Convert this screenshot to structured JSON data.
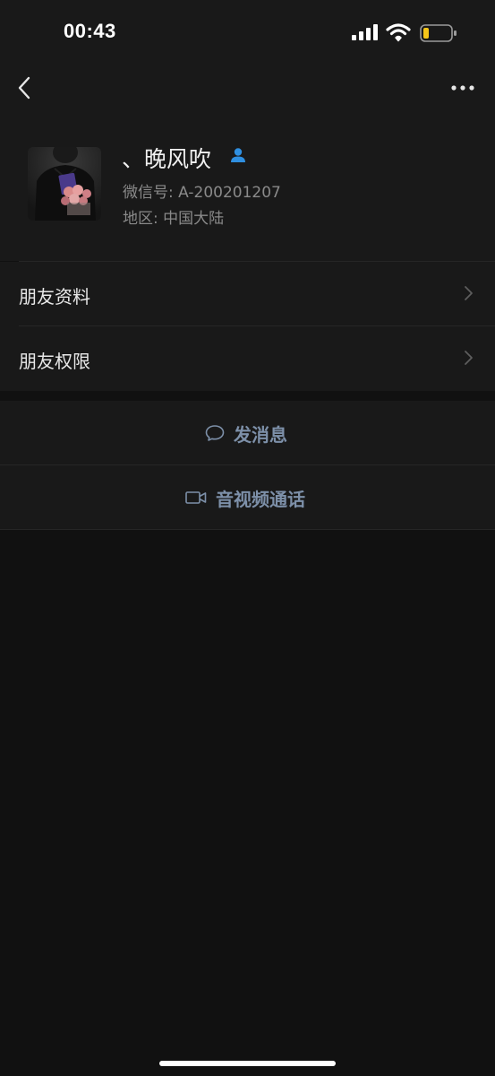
{
  "status_bar": {
    "time": "00:43",
    "icons": [
      "signal-icon",
      "wifi-icon",
      "battery-icon"
    ],
    "battery_color": "#f5c518"
  },
  "nav": {
    "icons": [
      "back-icon",
      "more-icon"
    ]
  },
  "profile": {
    "nickname": "、晚风吹",
    "wechat_id": "微信号: A-200201207",
    "region": "地区: 中国大陆",
    "badge_icon": "contact-person-icon",
    "badge_color": "#2f8fe0"
  },
  "menu": {
    "friend_profile": "朋友资料",
    "friend_permissions": "朋友权限"
  },
  "actions": {
    "message": {
      "label": "发消息",
      "icon": "chat-bubble-icon"
    },
    "video_call": {
      "label": "音视频通话",
      "icon": "video-camera-icon"
    },
    "accent_color": "#7d90a9"
  }
}
